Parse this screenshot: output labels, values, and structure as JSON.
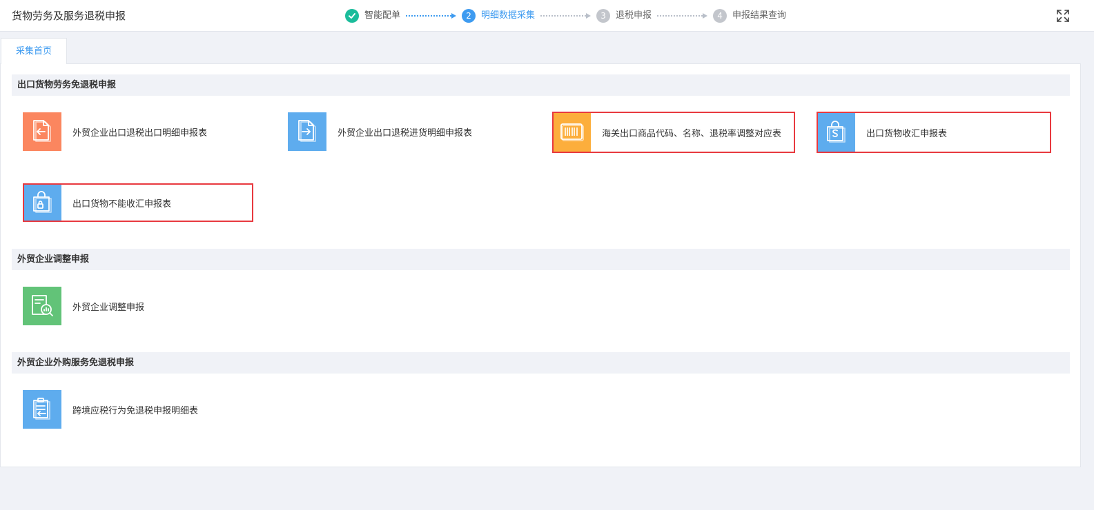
{
  "header": {
    "title": "货物劳务及服务退税申报",
    "steps": [
      {
        "number": "✓",
        "label": "智能配单",
        "state": "done"
      },
      {
        "number": "2",
        "label": "明细数据采集",
        "state": "active"
      },
      {
        "number": "3",
        "label": "退税申报",
        "state": "todo"
      },
      {
        "number": "4",
        "label": "申报结果查询",
        "state": "todo"
      }
    ],
    "fullscreen_icon": "expand-icon"
  },
  "tabs": [
    {
      "label": "采集首页",
      "active": true
    }
  ],
  "sections": [
    {
      "title": "出口货物劳务免退税申报",
      "items": [
        {
          "label": "外贸企业出口退税出口明细申报表",
          "icon": "document-export-icon",
          "color": "#fb865f",
          "highlighted": false
        },
        {
          "label": "外贸企业出口退税进货明细申报表",
          "icon": "document-import-icon",
          "color": "#5eacee",
          "highlighted": false
        },
        {
          "label": "海关出口商品代码、名称、退税率调整对应表",
          "icon": "barcode-icon",
          "color": "#fcae3c",
          "highlighted": true
        },
        {
          "label": "出口货物收汇申报表",
          "icon": "shopping-bag-dollar-icon",
          "color": "#5eacee",
          "highlighted": true
        },
        {
          "label": "出口货物不能收汇申报表",
          "icon": "shopping-bag-lock-icon",
          "color": "#5eacee",
          "highlighted": true
        }
      ]
    },
    {
      "title": "外贸企业调整申报",
      "items": [
        {
          "label": "外贸企业调整申报",
          "icon": "document-search-chart-icon",
          "color": "#62c378",
          "highlighted": false
        }
      ]
    },
    {
      "title": "外贸企业外购服务免退税申报",
      "items": [
        {
          "label": "跨境应税行为免退税申报明细表",
          "icon": "clipboard-list-icon",
          "color": "#5eacee",
          "highlighted": false
        }
      ]
    }
  ],
  "colors": {
    "accent": "#3e9bf0",
    "done": "#1bbc9b",
    "highlight_border": "#e8393f",
    "section_bg": "#f0f2f7"
  }
}
